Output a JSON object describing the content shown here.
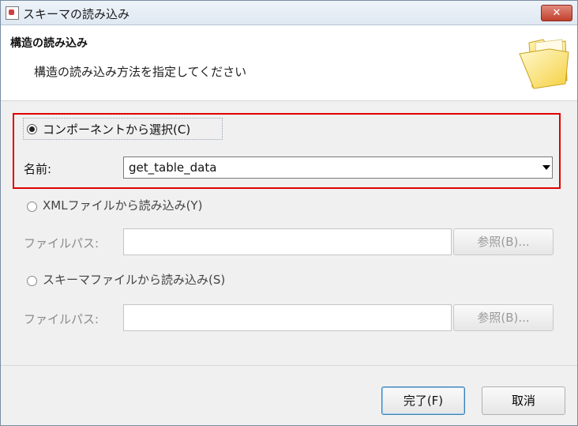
{
  "window": {
    "title": "スキーマの読み込み",
    "close_label": "✕"
  },
  "header": {
    "title": "構造の読み込み",
    "description": "構造の読み込み方法を指定してください"
  },
  "options": {
    "component": {
      "label": "コンポーネントから選択(C)",
      "selected": true,
      "name_label": "名前:",
      "name_value": "get_table_data"
    },
    "xml": {
      "label": "XMLファイルから読み込み(Y)",
      "selected": false,
      "path_label": "ファイルパス:",
      "path_value": "",
      "browse_label": "参照(B)..."
    },
    "schema": {
      "label": "スキーマファイルから読み込み(S)",
      "selected": false,
      "path_label": "ファイルパス:",
      "path_value": "",
      "browse_label": "参照(B)..."
    }
  },
  "footer": {
    "finish_label": "完了(F)",
    "cancel_label": "取消"
  },
  "colors": {
    "highlight_border": "#e00000",
    "title_bar": "#dfe8f2",
    "close_button": "#c2402c"
  }
}
